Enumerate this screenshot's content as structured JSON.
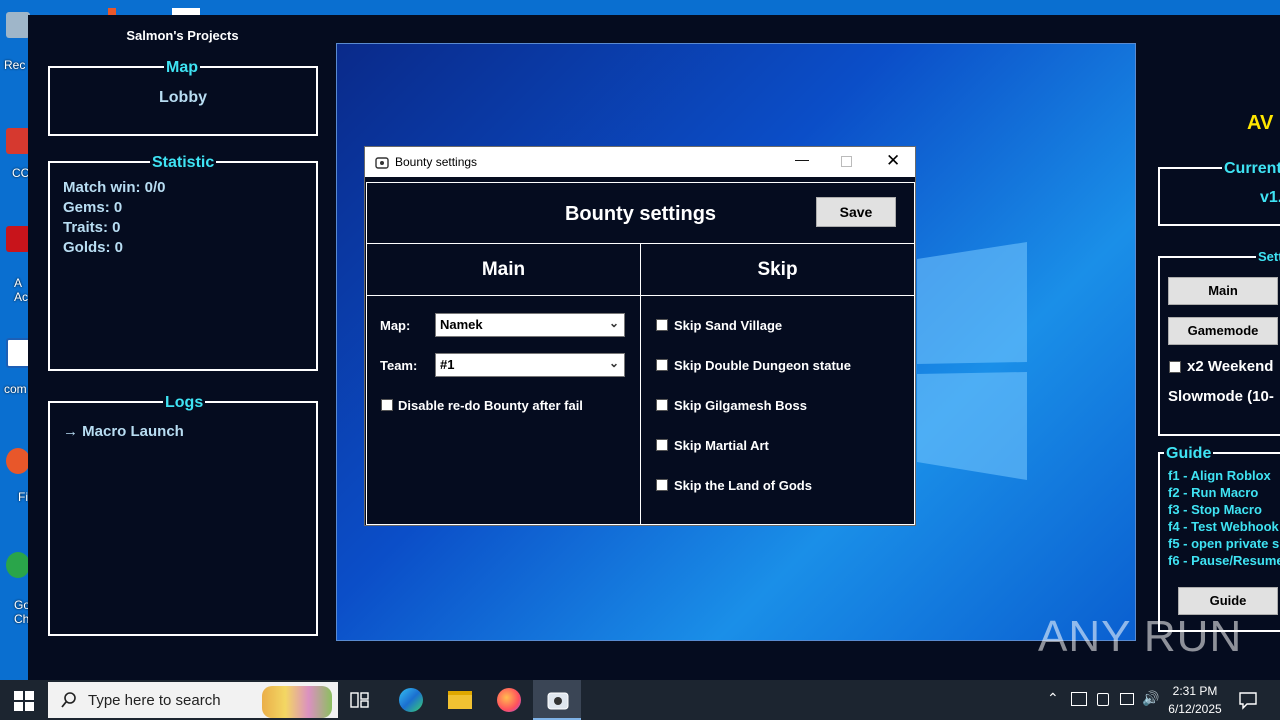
{
  "desktop": {
    "icons": [
      {
        "label": "Rec",
        "color": "#9fb6c9"
      },
      {
        "label": "CC",
        "color": "#d6392f"
      },
      {
        "label": "A\nAc",
        "color": "#c8141b"
      },
      {
        "label": "com",
        "color": "#1d5fb5"
      },
      {
        "label": "Fi",
        "color": "#e8572a"
      },
      {
        "label": "Go\nCh",
        "color": "#2aa54a"
      }
    ]
  },
  "macro": {
    "title": "Salmon's Projects",
    "map": {
      "legend": "Map",
      "value": "Lobby"
    },
    "statistic": {
      "legend": "Statistic",
      "lines": [
        "Match win: 0/0",
        "Gems: 0",
        "Traits: 0",
        "Golds: 0"
      ]
    },
    "logs": {
      "legend": "Logs",
      "entries": [
        "→ Macro Launch"
      ]
    },
    "right": {
      "av_title": "AV",
      "current_legend": "Current",
      "current_value": "v1.",
      "settings_legend": "Sett",
      "main_button": "Main",
      "gamemode_button": "Gamemode",
      "weekend_label": "x2 Weekend",
      "slowmode_label": "Slowmode (10-",
      "guide_legend": "Guide",
      "guide_lines": [
        "f1  - Align Roblox",
        "f2  - Run Macro",
        "f3  - Stop Macro",
        "f4  - Test Webhook",
        "f5  - open private s",
        "f6  - Pause/Resume"
      ],
      "guide_button": "Guide"
    }
  },
  "dialog": {
    "window_title": "Bounty settings",
    "heading": "Bounty settings",
    "save_label": "Save",
    "main": {
      "header": "Main",
      "map_label": "Map:",
      "map_value": "Namek",
      "team_label": "Team:",
      "team_value": "#1",
      "disable_redo_label": "Disable re-do Bounty after fail"
    },
    "skip": {
      "header": "Skip",
      "options": [
        "Skip Sand Village",
        "Skip Double Dungeon statue",
        "Skip Gilgamesh Boss",
        "Skip Martial Art",
        "Skip the Land of Gods"
      ]
    }
  },
  "taskbar": {
    "search_placeholder": "Type here to search",
    "time": "2:31 PM",
    "date": "6/12/2025"
  },
  "watermark": "ANY RUN",
  "colors": {
    "accent": "#3fe3f3",
    "macro_bg": "#050c1f",
    "taskbar": "#1c2530",
    "yellow_title": "#ffe600"
  }
}
